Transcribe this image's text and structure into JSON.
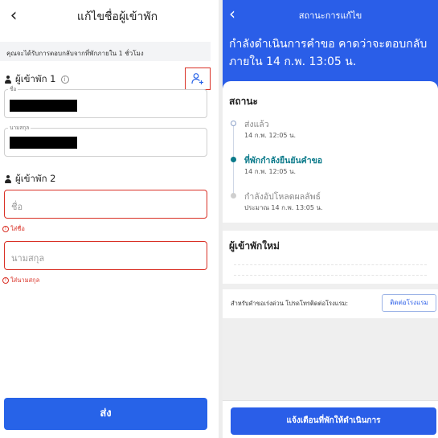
{
  "left": {
    "header": {
      "back_icon": "chevron-left-icon",
      "title": "แก้ไขชื่อผู้เข้าพัก"
    },
    "notice": "คุณจะได้รับการตอบกลับจากที่พักภายใน 1 ชั่วโมง",
    "guest1": {
      "heading": "ผู้เข้าพัก 1",
      "first_name_label": "ชื่อ",
      "last_name_label": "นามสกุล"
    },
    "guest2": {
      "heading": "ผู้เข้าพัก 2",
      "first_name_placeholder": "ชื่อ",
      "first_name_error": "ใส่ชื่อ",
      "last_name_placeholder": "นามสกุล",
      "last_name_error": "ใส่นามสกุล"
    },
    "submit_label": "ส่ง",
    "colors": {
      "accent": "#2763e8",
      "error": "#d93025"
    }
  },
  "right": {
    "header": {
      "back_icon": "chevron-left-icon",
      "title": "สถานะการแก้ไข"
    },
    "banner": "กำลังดำเนินการคำขอ คาดว่าจะตอบกลับภายใน 14 ก.พ. 13:05 น.",
    "status": {
      "heading": "สถานะ",
      "steps": [
        {
          "title": "ส่งแล้ว",
          "time": "14 ก.พ. 12:05 น.",
          "state": "done"
        },
        {
          "title": "ที่พักกำลังยืนยันคำขอ",
          "time": "14 ก.พ. 12:05 น.",
          "state": "active"
        },
        {
          "title": "กำลังอัปโหลดผลลัพธ์",
          "time": "ประมาณ 14 ก.พ. 13:05 น.",
          "state": "pending"
        }
      ]
    },
    "new_guests_heading": "ผู้เข้าพักใหม่",
    "contact": {
      "text": "สำหรับคำขอเร่งด่วน โปรดโทรติดต่อโรงแรม:",
      "button": "ติดต่อโรงแรม"
    },
    "notify_button": "แจ้งเตือนที่พักให้ดำเนินการ",
    "colors": {
      "header": "#2a5ee8",
      "active_step": "#0b7a8a"
    }
  }
}
